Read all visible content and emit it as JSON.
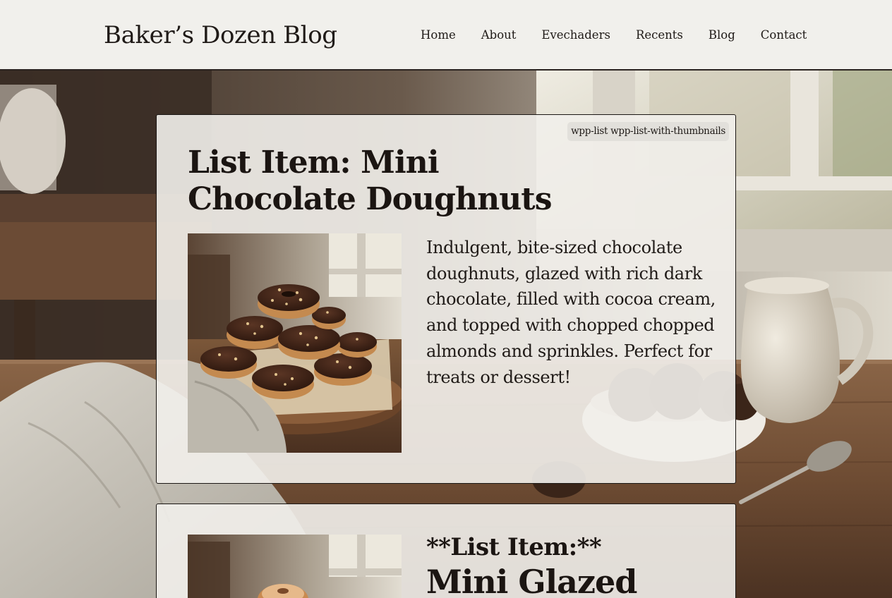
{
  "header": {
    "site_title": "Baker’s Dozen Blog",
    "nav": [
      {
        "label": "Home"
      },
      {
        "label": "About"
      },
      {
        "label": "Evechaders"
      },
      {
        "label": "Recents"
      },
      {
        "label": "Blog"
      },
      {
        "label": "Contact"
      }
    ]
  },
  "list": {
    "class_badge": "wpp-list wpp-list-with-thumbnails",
    "items": [
      {
        "title": "List Item: Mini Chocolate Doughnuts",
        "description": "Indulgent, bite-sized chocolate doughnuts, glazed with rich dark chocolate, filled with cocoa cream, and topped with chopped chopped almonds and sprinkles. Perfect for treats or dessert!",
        "thumbnail_icon": "chocolate-doughnuts-photo"
      },
      {
        "kicker": "**List Item:**",
        "title": "Mini Glazed",
        "thumbnail_icon": "glazed-doughnut-photo"
      }
    ]
  },
  "colors": {
    "header_bg": "#f1f0ec",
    "card_bg": "#f1efea",
    "text": "#1f1a17",
    "wood": "#6b4a30"
  }
}
